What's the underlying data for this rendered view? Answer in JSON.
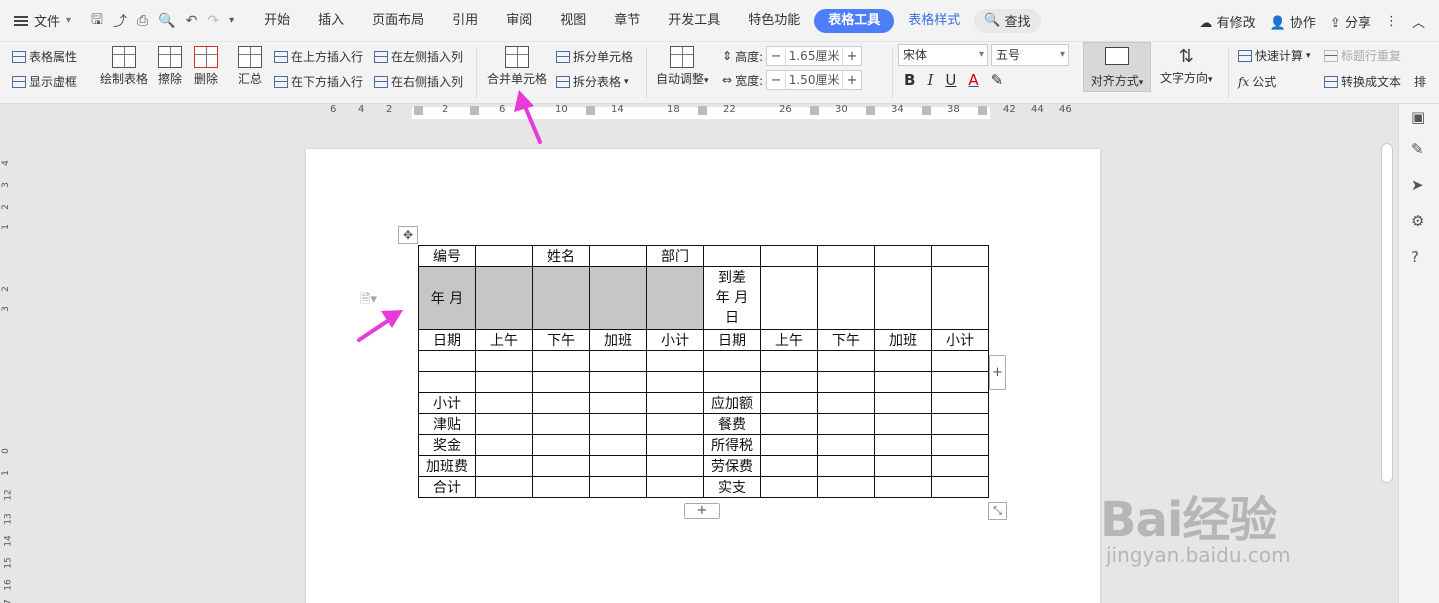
{
  "menubar": {
    "file_label": "文件",
    "tabs": [
      "开始",
      "插入",
      "页面布局",
      "引用",
      "审阅",
      "视图",
      "章节",
      "开发工具",
      "特色功能"
    ],
    "active_tab": "表格工具",
    "next_tab": "表格样式",
    "search_label": "查找",
    "right": {
      "modify": "有修改",
      "collab": "协作",
      "share": "分享"
    }
  },
  "ribbon": {
    "table_props": "表格属性",
    "show_grid": "显示虚框",
    "draw_table": "绘制表格",
    "erase": "擦除",
    "delete": "删除",
    "summary": "汇总",
    "insert_above": "在上方插入行",
    "insert_below": "在下方插入行",
    "insert_left": "在左侧插入列",
    "insert_right": "在右侧插入列",
    "merge_cells": "合并单元格",
    "split_cells": "拆分单元格",
    "split_table": "拆分表格",
    "auto_adjust": "自动调整",
    "height_label": "高度:",
    "height_value": "1.65厘米",
    "width_label": "宽度:",
    "width_value": "1.50厘米",
    "font": "宋体",
    "size": "五号",
    "align": "对齐方式",
    "text_dir": "文字方向",
    "quick_calc": "快速计算",
    "title_repeat": "标题行重复",
    "formula": "公式",
    "to_text": "转换成文本",
    "more": "排"
  },
  "ruler": {
    "ticks": [
      "6",
      "4",
      "2",
      "2",
      "6",
      "10",
      "14",
      "18",
      "22",
      "26",
      "30",
      "34",
      "38",
      "42",
      "44",
      "46"
    ]
  },
  "vruler": [
    "4",
    "3",
    "2",
    "1",
    "2",
    "3",
    "0",
    "1",
    "12",
    "13",
    "14",
    "15",
    "16",
    "17"
  ],
  "table": {
    "rows": [
      [
        "编号",
        "",
        "姓名",
        "",
        "部门",
        "",
        "",
        "",
        "",
        ""
      ],
      [
        "年   月",
        "",
        "",
        "",
        "",
        "到差\n年 月\n日",
        "",
        "",
        "",
        ""
      ],
      [
        "日期",
        "上午",
        "下午",
        "加班",
        "小计",
        "日期",
        "上午",
        "下午",
        "加班",
        "小计"
      ],
      [
        "",
        "",
        "",
        "",
        "",
        "",
        "",
        "",
        "",
        ""
      ],
      [
        "",
        "",
        "",
        "",
        "",
        "",
        "",
        "",
        "",
        ""
      ],
      [
        "小计",
        "",
        "",
        "",
        "",
        "应加额",
        "",
        "",
        "",
        ""
      ],
      [
        "津贴",
        "",
        "",
        "",
        "",
        "餐费",
        "",
        "",
        "",
        ""
      ],
      [
        "奖金",
        "",
        "",
        "",
        "",
        "所得税",
        "",
        "",
        "",
        ""
      ],
      [
        "加班费",
        "",
        "",
        "",
        "",
        "劳保费",
        "",
        "",
        "",
        ""
      ],
      [
        "合计",
        "",
        "",
        "",
        "",
        "实支",
        "",
        "",
        "",
        ""
      ]
    ],
    "shaded_row_index": 1,
    "shaded_cols": [
      0,
      1,
      2,
      3,
      4
    ]
  },
  "watermark": {
    "brand": "Bai经验",
    "url": "jingyan.baidu.com"
  },
  "colors": {
    "accent": "#4d7ef7",
    "arrow": "#e83ad6",
    "shade": "#c6c6c6"
  }
}
